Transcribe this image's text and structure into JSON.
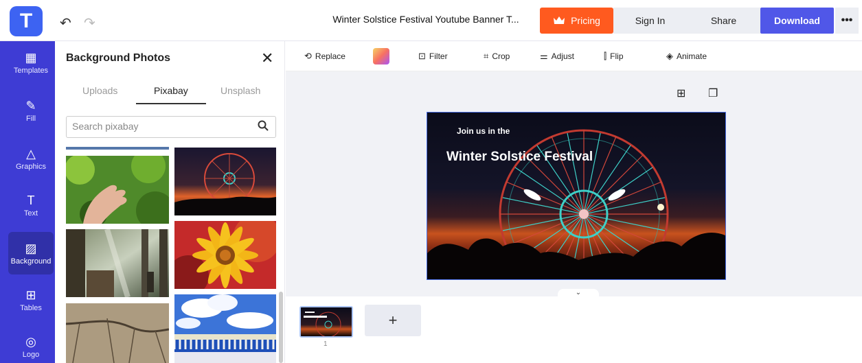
{
  "app": {
    "logo_letter": "T",
    "undo_glyph": "↶",
    "redo_glyph": "↷",
    "document_title": "Winter Solstice Festival Youtube Banner T...",
    "accent_color": "#3e3cd4",
    "brand_color": "#3d63f2"
  },
  "header": {
    "pricing_label": "Pricing",
    "signin_label": "Sign In",
    "share_label": "Share",
    "download_label": "Download",
    "more_label": "•••"
  },
  "sidebar": {
    "items": [
      {
        "label": "Templates",
        "icon": "layout-icon"
      },
      {
        "label": "Fill",
        "icon": "pen-icon"
      },
      {
        "label": "Graphics",
        "icon": "shapes-icon"
      },
      {
        "label": "Text",
        "icon": "text-icon"
      },
      {
        "label": "Background",
        "icon": "background-icon"
      },
      {
        "label": "Tables",
        "icon": "table-icon"
      },
      {
        "label": "Logo",
        "icon": "logo-icon"
      }
    ],
    "active_index": 4
  },
  "panel": {
    "title": "Background Photos",
    "close_glyph": "✕",
    "tabs": [
      "Uploads",
      "Pixabay",
      "Unsplash"
    ],
    "active_tab": "Pixabay",
    "search_placeholder": "Search pixabay",
    "photos": [
      "hand-leaves",
      "ferris-wheel",
      "forest-shrine",
      "yellow-flower",
      "cracked-earth",
      "sky-railing"
    ]
  },
  "toolbar": {
    "replace_label": "Replace",
    "filter_label": "Filter",
    "crop_label": "Crop",
    "adjust_label": "Adjust",
    "flip_label": "Flip",
    "animate_label": "Animate"
  },
  "canvas": {
    "banner_subtitle": "Join us in the",
    "banner_title": "Winter Solstice Festival"
  },
  "slides": {
    "page_numbers": [
      "1"
    ],
    "add_label": "+"
  }
}
